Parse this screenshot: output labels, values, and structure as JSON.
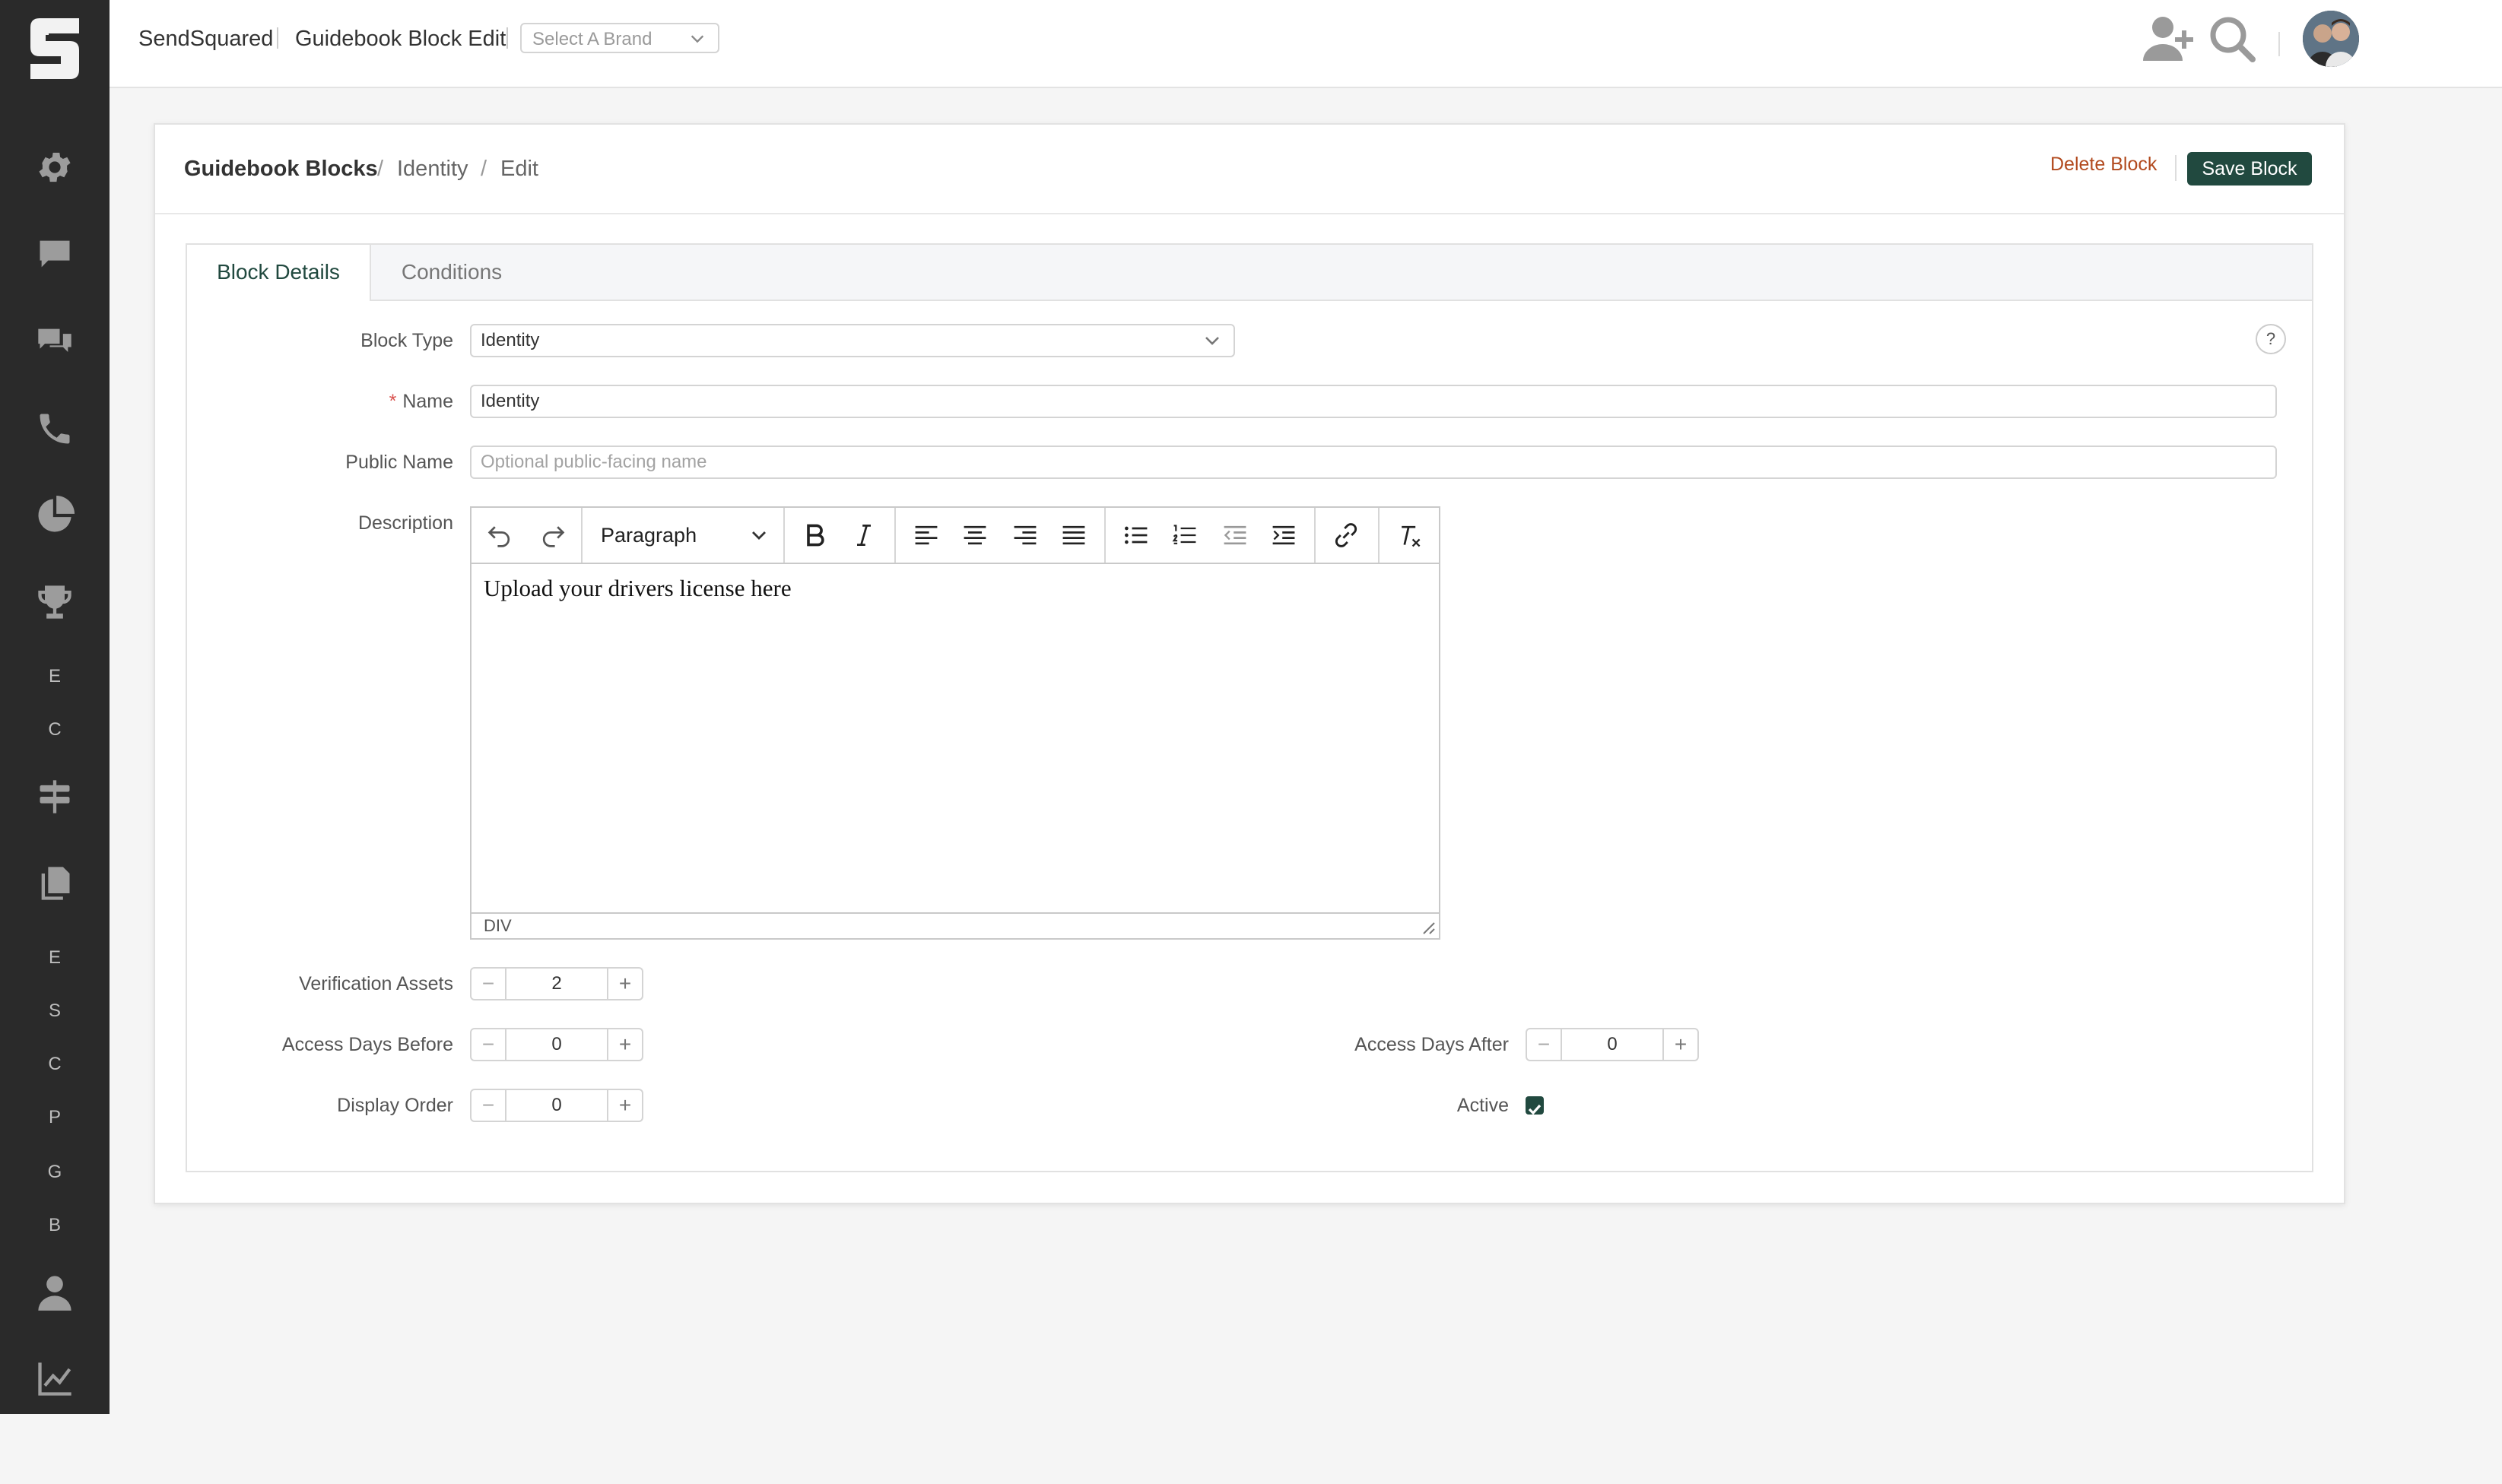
{
  "topbar": {
    "app_name": "SendSquared",
    "page_name": "Guidebook Block Edit",
    "brand_placeholder": "Select A Brand",
    "icons": [
      "add-user-icon",
      "search-icon"
    ]
  },
  "sidebar": {
    "icons": [
      "gear-icon",
      "chat-icon",
      "conversations-icon",
      "phone-icon",
      "pie-chart-icon",
      "trophy-icon",
      "signpost-icon",
      "copy-icon",
      "user-icon",
      "chart-line-icon"
    ],
    "letters_a": [
      "E",
      "C"
    ],
    "letters_b": [
      "E",
      "S",
      "C",
      "P",
      "G",
      "B"
    ]
  },
  "breadcrumb": {
    "root": "Guidebook Blocks",
    "sep": "/",
    "level2": "Identity",
    "level3": "Edit"
  },
  "actions": {
    "delete": "Delete Block",
    "save": "Save Block"
  },
  "tabs": {
    "details": "Block Details",
    "conditions": "Conditions"
  },
  "form": {
    "block_type_label": "Block Type",
    "block_type_value": "Identity",
    "name_required": "*",
    "name_label": "Name",
    "name_value": "Identity",
    "public_name_label": "Public Name",
    "public_name_placeholder": "Optional public-facing name",
    "description_label": "Description",
    "help": "?",
    "verification_assets_label": "Verification Assets",
    "verification_assets_value": "2",
    "access_days_before_label": "Access Days Before",
    "access_days_before_value": "0",
    "access_days_after_label": "Access Days After",
    "access_days_after_value": "0",
    "display_order_label": "Display Order",
    "display_order_value": "0",
    "active_label": "Active",
    "active_checked": true
  },
  "editor": {
    "format": "Paragraph",
    "content": "Upload your drivers license here",
    "status_path": "DIV"
  },
  "colors": {
    "primary": "#21493f",
    "danger_link": "#b24a1e",
    "sidebar_bg": "#2a2a2a"
  }
}
